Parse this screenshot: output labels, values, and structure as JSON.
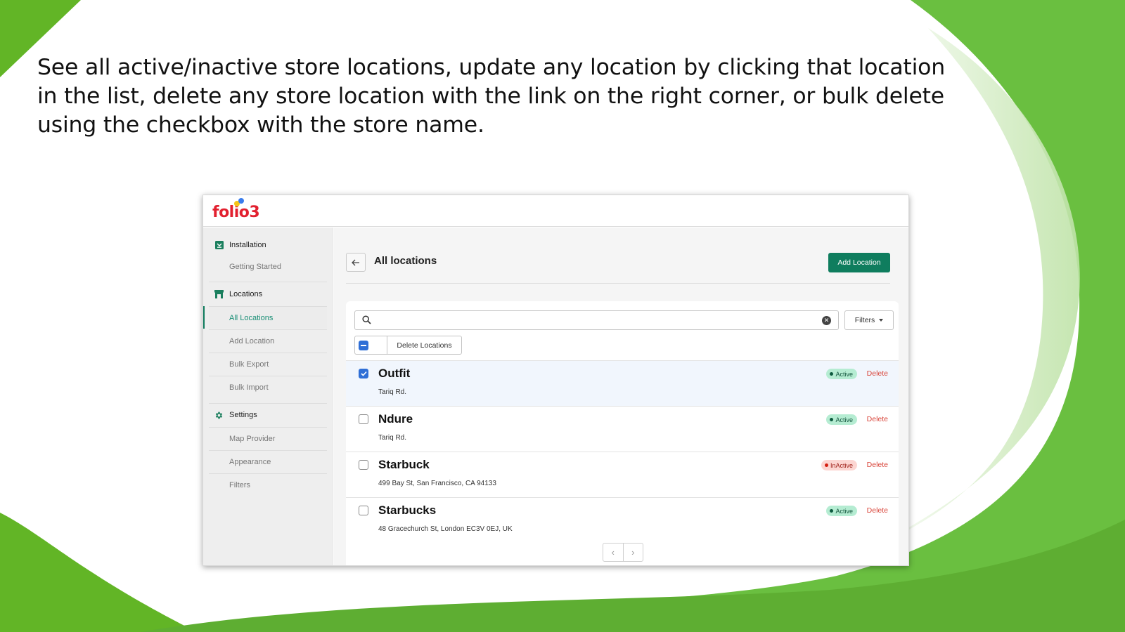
{
  "slide": {
    "headline": "See all active/inactive store locations, update any location by clicking that location in the list, delete any store location with the link on the right corner, or bulk delete using the checkbox with the store name.",
    "colors": {
      "green_primary": "#6abf40",
      "green_dark": "#5aad2a",
      "green_light": "#d8efcc"
    }
  },
  "app": {
    "logo": "folio3",
    "sidebar": {
      "sections": [
        {
          "label": "Installation",
          "icon": "download-box-icon",
          "items": [
            {
              "label": "Getting Started",
              "active": false
            }
          ]
        },
        {
          "label": "Locations",
          "icon": "store-icon",
          "items": [
            {
              "label": "All Locations",
              "active": true
            },
            {
              "label": "Add Location",
              "active": false
            },
            {
              "label": "Bulk Export",
              "active": false
            },
            {
              "label": "Bulk Import",
              "active": false
            }
          ]
        },
        {
          "label": "Settings",
          "icon": "gear-icon",
          "items": [
            {
              "label": "Map Provider",
              "active": false
            },
            {
              "label": "Appearance",
              "active": false
            },
            {
              "label": "Filters",
              "active": false
            }
          ]
        }
      ]
    },
    "main": {
      "back_icon": "arrow-left-icon",
      "title": "All locations",
      "add_button": "Add Location",
      "search": {
        "value": "",
        "placeholder": "",
        "icon": "search-icon",
        "clear_icon": "clear-circle-icon"
      },
      "filters_button": "Filters",
      "bulk": {
        "checkbox_state": "indeterminate",
        "delete_label": "Delete Locations"
      },
      "locations": [
        {
          "name": "Outfit",
          "address": "Tariq Rd.",
          "status": "Active",
          "checked": true,
          "delete_label": "Delete"
        },
        {
          "name": "Ndure",
          "address": "Tariq Rd.",
          "status": "Active",
          "checked": false,
          "delete_label": "Delete"
        },
        {
          "name": "Starbuck",
          "address": "499 Bay St, San Francisco, CA 94133",
          "status": "InActive",
          "checked": false,
          "delete_label": "Delete"
        },
        {
          "name": "Starbucks",
          "address": "48 Gracechurch St, London EC3V 0EJ, UK",
          "status": "Active",
          "checked": false,
          "delete_label": "Delete"
        }
      ],
      "pagination": {
        "prev": "‹",
        "next": "›"
      },
      "colors": {
        "accent": "#0f7d5e",
        "checkbox": "#2f6fd6",
        "delete": "#d9453a",
        "active_badge": "#b5ecd2",
        "inactive_badge": "#fcd6d2"
      }
    }
  }
}
